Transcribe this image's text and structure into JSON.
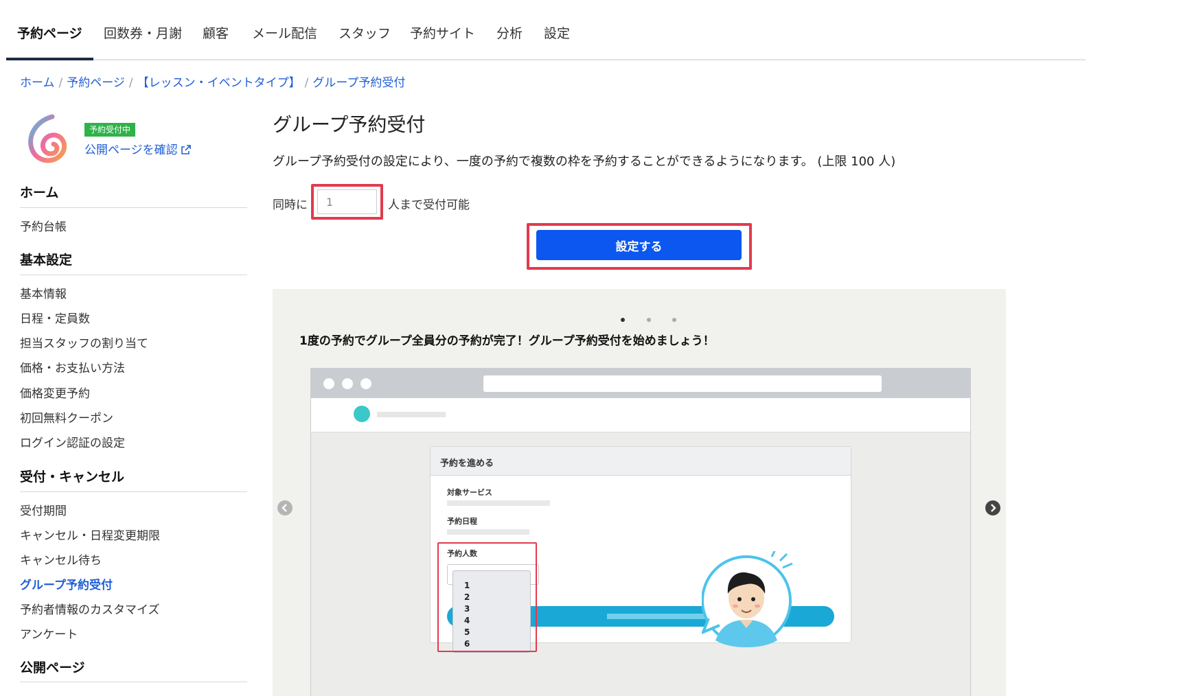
{
  "nav": {
    "tabs": [
      {
        "label": "予約ページ",
        "active": true
      },
      {
        "label": "回数券・月謝"
      },
      {
        "label": "顧客"
      },
      {
        "label": "メール配信"
      },
      {
        "label": "スタッフ"
      },
      {
        "label": "予約サイト"
      },
      {
        "label": "分析"
      },
      {
        "label": "設定"
      }
    ]
  },
  "breadcrumb": [
    "ホーム",
    "予約ページ",
    "【レッスン・イベントタイプ】",
    "グループ予約受付"
  ],
  "sidebar": {
    "badge": "予約受付中",
    "public_link": "公開ページを確認",
    "sections": [
      {
        "heading": "ホーム",
        "items": [
          "予約台帳"
        ]
      },
      {
        "heading": "基本設定",
        "items": [
          "基本情報",
          "日程・定員数",
          "担当スタッフの割り当て",
          "価格・お支払い方法",
          "価格変更予約",
          "初回無料クーポン",
          "ログイン認証の設定"
        ]
      },
      {
        "heading": "受付・キャンセル",
        "items": [
          "受付期間",
          "キャンセル・日程変更期限",
          "キャンセル待ち",
          "グループ予約受付",
          "予約者情報のカスタマイズ",
          "アンケート"
        ]
      },
      {
        "heading": "公開ページ",
        "items": []
      }
    ],
    "active_item": "グループ予約受付"
  },
  "main": {
    "title": "グループ予約受付",
    "description": "グループ予約受付の設定により、一度の予約で複数の枠を予約することができるようになります。 (上限 100 人)",
    "prefix": "同時に",
    "input_value": "1",
    "suffix": "人まで受付可能",
    "submit_label": "設定する"
  },
  "carousel": {
    "slide_count": 3,
    "active_slide": 1,
    "caption": "1度の予約でグループ全員分の予約が完了！グループ予約受付を始めましょう！",
    "mock": {
      "card_title": "予約を進める",
      "field_service": "対象サービス",
      "field_date": "予約日程",
      "field_people": "予約人数",
      "options": [
        "1",
        "2",
        "3",
        "4",
        "5",
        "6"
      ]
    }
  },
  "colors": {
    "link": "#1f5fd6",
    "primary_button": "#0b57f0",
    "badge": "#2fb24a",
    "highlight": "#e23a4e"
  }
}
